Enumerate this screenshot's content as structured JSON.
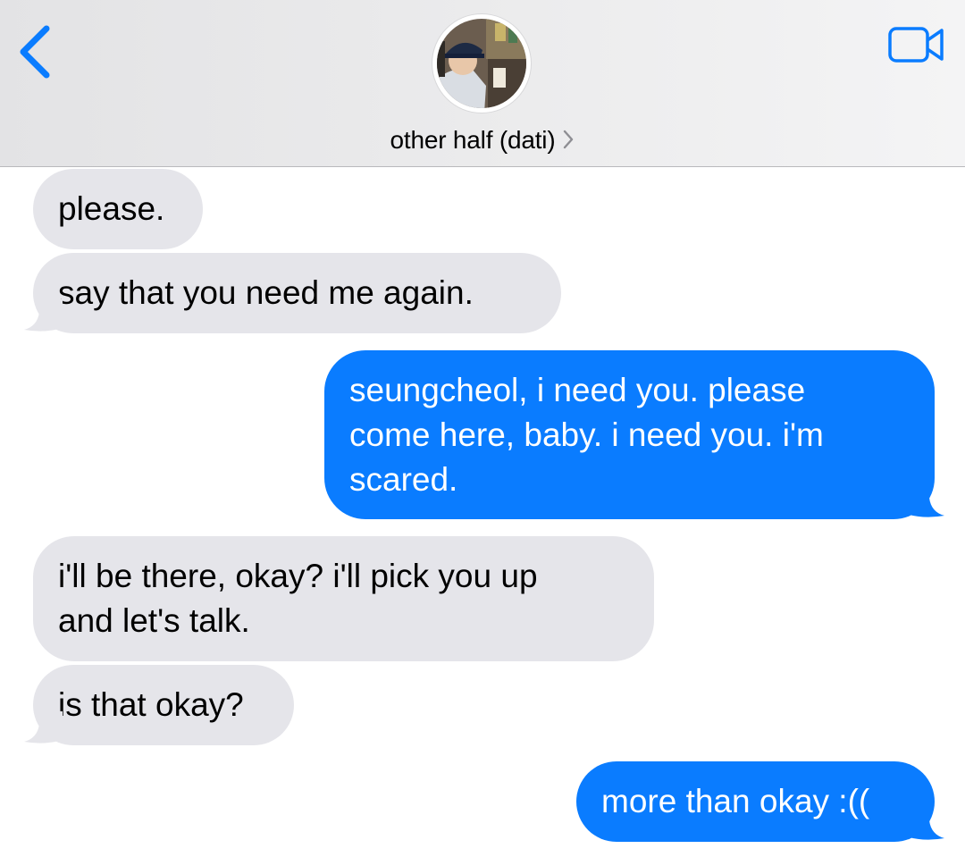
{
  "header": {
    "contact_name": "other half (dati)",
    "back_icon": "chevron-left-icon",
    "video_icon": "video-camera-icon",
    "accent_color": "#0a7cff"
  },
  "messages": [
    {
      "direction": "incoming",
      "text": "please."
    },
    {
      "direction": "incoming",
      "text": "say that you need me again."
    },
    {
      "direction": "outgoing",
      "lines": [
        "seungcheol, i need you. please",
        "come here, baby. i need you. i'm",
        "scared."
      ]
    },
    {
      "direction": "incoming",
      "lines": [
        "i'll be there, okay? i'll pick you up",
        "and let's talk."
      ]
    },
    {
      "direction": "incoming",
      "text": "is that okay?"
    },
    {
      "direction": "outgoing",
      "text": "more than okay :(("
    }
  ],
  "colors": {
    "incoming_bubble": "#e5e5ea",
    "outgoing_bubble": "#0a7cff"
  }
}
